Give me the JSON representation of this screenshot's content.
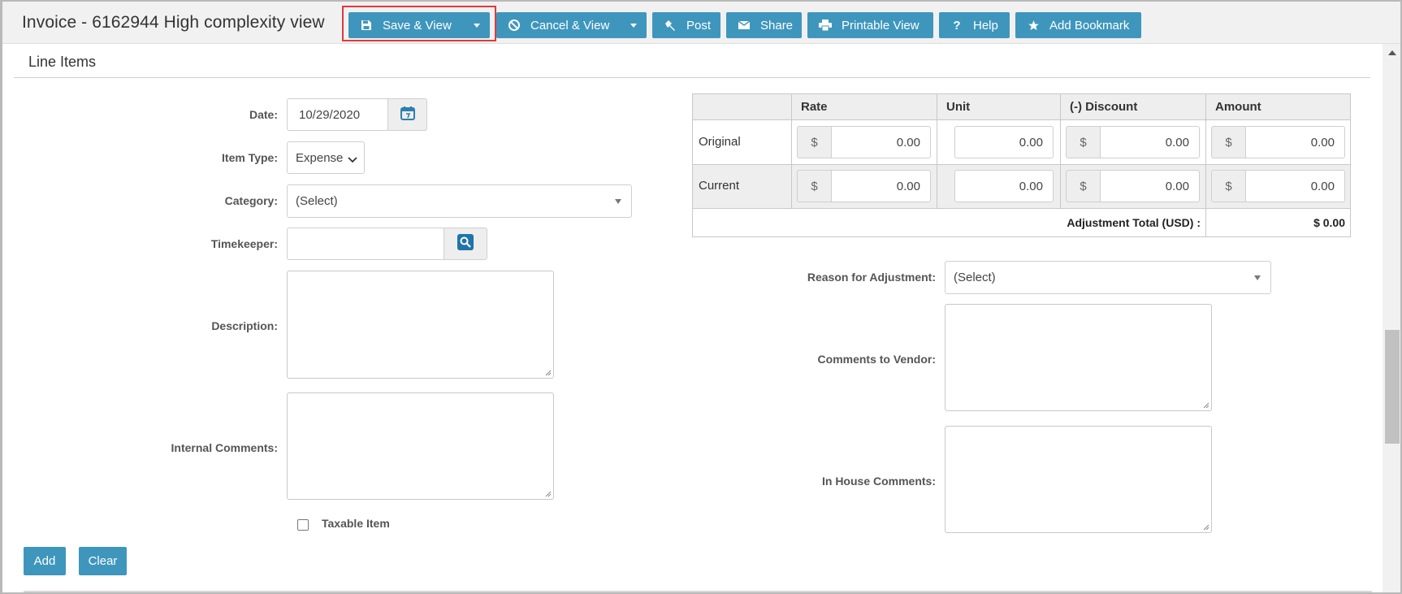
{
  "window": {
    "title": "Invoice - 6162944 High complexity view"
  },
  "toolbar": {
    "save_view": "Save & View",
    "cancel_view": "Cancel & View",
    "post": "Post",
    "share": "Share",
    "printable_view": "Printable View",
    "help": "Help",
    "add_bookmark": "Add Bookmark",
    "accent_color": "#3f96bd",
    "highlight_color": "#e03a3a"
  },
  "section": {
    "title": "Line Items"
  },
  "form": {
    "date_label": "Date:",
    "date_value": "10/29/2020",
    "item_type_label": "Item Type:",
    "item_type_value": "Expense",
    "category_label": "Category:",
    "category_value": "(Select)",
    "timekeeper_label": "Timekeeper:",
    "timekeeper_value": "",
    "description_label": "Description:",
    "internal_comments_label": "Internal Comments:",
    "taxable_label": "Taxable Item",
    "taxable_checked": false,
    "add_button": "Add",
    "clear_button": "Clear"
  },
  "adjustment_table": {
    "headers": [
      "Rate",
      "Unit",
      "(-) Discount",
      "Amount"
    ],
    "currency_symbol": "$",
    "rows": [
      {
        "label": "Original",
        "rate": "0.00",
        "unit": "0.00",
        "discount": "0.00",
        "amount": "0.00"
      },
      {
        "label": "Current",
        "rate": "0.00",
        "unit": "0.00",
        "discount": "0.00",
        "amount": "0.00"
      }
    ],
    "total_label": "Adjustment Total  (USD) :",
    "total_value": "$ 0.00"
  },
  "adjustment_form": {
    "reason_label": "Reason for Adjustment:",
    "reason_value": "(Select)",
    "comments_vendor_label": "Comments to Vendor:",
    "in_house_label": "In House Comments:"
  }
}
